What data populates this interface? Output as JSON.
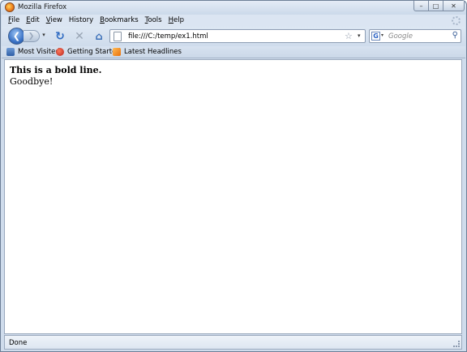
{
  "window": {
    "title": "Mozilla Firefox",
    "controls": {
      "minimize": "–",
      "maximize": "□",
      "close": "✕"
    }
  },
  "menubar": {
    "items": [
      {
        "label": "File",
        "accel": "F",
        "rest": "ile"
      },
      {
        "label": "Edit",
        "accel": "E",
        "rest": "dit"
      },
      {
        "label": "View",
        "accel": "V",
        "rest": "iew"
      },
      {
        "label": "History",
        "accel": "",
        "rest": "History"
      },
      {
        "label": "Bookmarks",
        "accel": "B",
        "rest": "ookmarks"
      },
      {
        "label": "Tools",
        "accel": "T",
        "rest": "ools"
      },
      {
        "label": "Help",
        "accel": "H",
        "rest": "elp"
      }
    ]
  },
  "navbar": {
    "back_glyph": "❮",
    "forward_glyph": "❯",
    "dropdown_glyph": "▾",
    "reload_glyph": "↻",
    "stop_glyph": "✕",
    "home_glyph": "⌂",
    "url": "file:///C:/temp/ex1.html",
    "star_glyph": "☆",
    "search": {
      "engine_letter": "G",
      "placeholder": "Google",
      "button_glyph": "⚲"
    }
  },
  "bookmarks": {
    "items": [
      {
        "label": "Most Visited"
      },
      {
        "label": "Getting Started"
      },
      {
        "label": "Latest Headlines"
      }
    ]
  },
  "page": {
    "bold_line": "This is a bold line.",
    "plain_line": "Goodbye!"
  },
  "status": {
    "text": "Done"
  },
  "colors": {
    "chrome": "#cfdcec",
    "accent": "#3b73c6"
  }
}
